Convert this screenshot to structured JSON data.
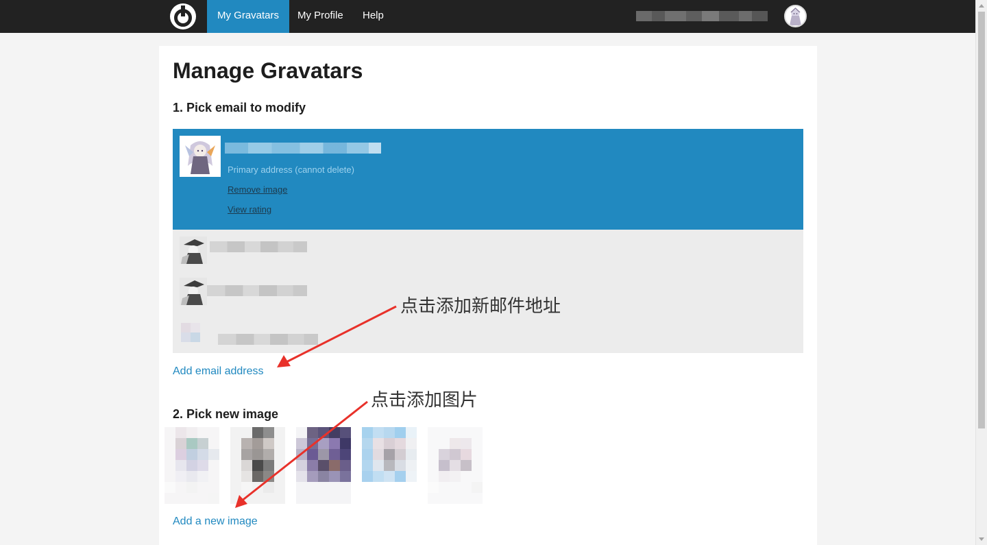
{
  "nav": {
    "items": [
      {
        "label": "My Gravatars"
      },
      {
        "label": "My Profile"
      },
      {
        "label": "Help"
      }
    ]
  },
  "main": {
    "title": "Manage Gravatars",
    "section1_title": "1. Pick email to modify",
    "selected_email": {
      "primary_note": "Primary address (cannot delete)",
      "remove_image": "Remove image",
      "view_rating": "View rating"
    },
    "add_email_link": "Add email address",
    "section2_title": "2. Pick new image",
    "add_image_link": "Add a new image"
  },
  "annotations": {
    "add_email_hint": "点击添加新邮件地址",
    "add_image_hint": "点击添加图片"
  },
  "colors": {
    "accent": "#2189c0",
    "annotation_arrow": "#e8312a"
  }
}
